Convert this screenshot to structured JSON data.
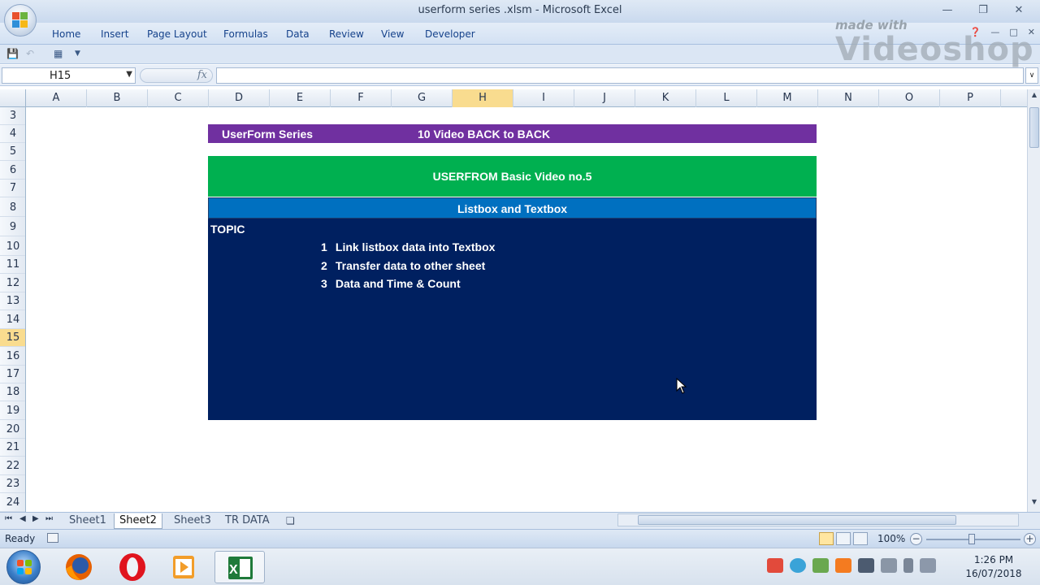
{
  "window": {
    "title": "userform series .xlsm - Microsoft Excel"
  },
  "ribbon": {
    "tabs": [
      "Home",
      "Insert",
      "Page Layout",
      "Formulas",
      "Data",
      "Review",
      "View",
      "Developer"
    ]
  },
  "watermark": {
    "small": "made with",
    "big": "Videoshop"
  },
  "formula_bar": {
    "name_box": "H15",
    "fx_label": "fx",
    "formula": ""
  },
  "grid": {
    "columns": [
      "A",
      "B",
      "C",
      "D",
      "E",
      "F",
      "G",
      "H",
      "I",
      "J",
      "K",
      "L",
      "M",
      "N",
      "O",
      "P"
    ],
    "rows": [
      "3",
      "4",
      "5",
      "6",
      "7",
      "8",
      "9",
      "10",
      "11",
      "12",
      "13",
      "14",
      "15",
      "16",
      "17",
      "18",
      "19",
      "20",
      "21",
      "22",
      "23",
      "24"
    ]
  },
  "content": {
    "row4_left": "UserForm Series",
    "row4_right": "10 Video BACK to BACK",
    "green_title": "USERFROM Basic Video no.5",
    "blue_title": "Listbox and Textbox",
    "topic_label": "TOPIC",
    "topics": [
      {
        "num": "1",
        "text": "Link listbox data into Textbox"
      },
      {
        "num": "2",
        "text": "Transfer data to other sheet"
      },
      {
        "num": "3",
        "text": "Data and Time & Count"
      }
    ],
    "colors": {
      "purple": "#7030a0",
      "green": "#00b050",
      "blue": "#0070c0",
      "navy": "#002060"
    }
  },
  "sheet_tabs": [
    "Sheet1",
    "Sheet2",
    "Sheet3",
    "TR DATA"
  ],
  "active_sheet": "Sheet2",
  "status": {
    "ready": "Ready",
    "zoom": "100%"
  },
  "taskbar": {
    "apps": [
      "firefox-icon",
      "opera-icon",
      "media-player-icon",
      "excel-icon"
    ],
    "time": "1:26 PM",
    "date": "16/07/2018"
  }
}
